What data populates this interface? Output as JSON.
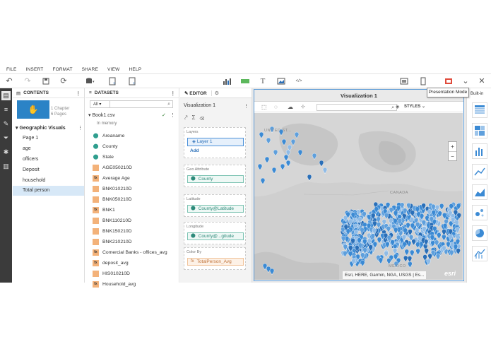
{
  "menu": [
    "FILE",
    "INSERT",
    "FORMAT",
    "SHARE",
    "VIEW",
    "HELP"
  ],
  "tooltip": "Presentation Mode",
  "contents": {
    "header": "CONTENTS",
    "chapter_info": [
      "1 Chapter",
      "6 Pages"
    ],
    "section": "Geographic Visuals",
    "pages": [
      "Page 1",
      "age",
      "officers",
      "Deposit",
      "household",
      "Total person"
    ],
    "selected_page": "Total person"
  },
  "datasets": {
    "header": "DATASETS",
    "filter": "All",
    "dataset_name": "Book1.csv",
    "status": "In memory",
    "fields": [
      {
        "name": "Areaname",
        "kind": "geo"
      },
      {
        "name": "County",
        "kind": "geo"
      },
      {
        "name": "State",
        "kind": "geo"
      },
      {
        "name": "AGE050210D",
        "kind": "num"
      },
      {
        "name": "Average Age",
        "kind": "fx"
      },
      {
        "name": "BNK010210D",
        "kind": "num"
      },
      {
        "name": "BNK050210D",
        "kind": "num"
      },
      {
        "name": "BNK1",
        "kind": "fx"
      },
      {
        "name": "BNK110210D",
        "kind": "num"
      },
      {
        "name": "BNK150210D",
        "kind": "num"
      },
      {
        "name": "BNK210210D",
        "kind": "num"
      },
      {
        "name": "Comercial Banks - offices_avg",
        "kind": "fx"
      },
      {
        "name": "deposit_avg",
        "kind": "fx"
      },
      {
        "name": "HIS010210D",
        "kind": "num"
      },
      {
        "name": "Household_avg",
        "kind": "fx"
      }
    ]
  },
  "editor": {
    "tab_editor": "EDITOR",
    "title": "Visualization 1",
    "layers_label": "Layers",
    "layer_name": "Layer 1",
    "add_label": "Add",
    "slots": [
      {
        "label": "Geo Attribute",
        "value": "County",
        "kind": "geo"
      },
      {
        "label": "Latitude",
        "value": "County@Latitude",
        "kind": "geo"
      },
      {
        "label": "Longitude",
        "value": "County@...gitude",
        "kind": "geo"
      },
      {
        "label": "Color By",
        "value": "TotalPerson_Avg",
        "kind": "num"
      }
    ]
  },
  "viz": {
    "title": "Visualization 1",
    "styles_label": "STYLES",
    "zoom_in": "+",
    "zoom_out": "−",
    "attribution": "Esri, HERE, Garmin, NGA, USGS | Es...",
    "esri_logo": "esri",
    "map_labels": {
      "us": "UNITED ST...",
      "canada": "CANADA",
      "mexico": "MÉXICO"
    },
    "pin_color": "#3b8ad4"
  },
  "right_panel": {
    "header": "Built-in"
  },
  "colors": {
    "accent": "#2b83c6",
    "rail": "#3b3b3b",
    "selected_row": "#d7e8f7"
  }
}
